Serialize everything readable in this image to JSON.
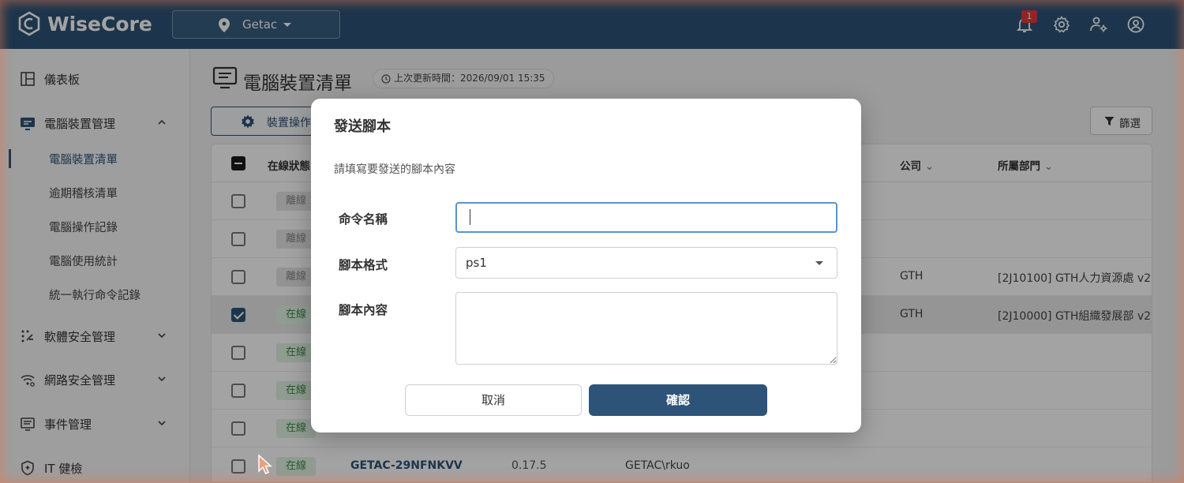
{
  "app": {
    "brand": "WiseCore",
    "site_selector": {
      "value": "Getac"
    },
    "notifications_count": "1"
  },
  "sidebar": {
    "items": [
      {
        "label": "儀表板",
        "icon": "dashboard-icon"
      },
      {
        "label": "電腦裝置管理",
        "icon": "computer-icon",
        "expanded": true,
        "children": [
          "電腦裝置清單",
          "逾期稽核清單",
          "電腦操作記錄",
          "電腦使用統計",
          "統一執行命令記錄"
        ]
      },
      {
        "label": "軟體安全管理",
        "icon": "software-icon"
      },
      {
        "label": "網路安全管理",
        "icon": "wifi-icon"
      },
      {
        "label": "事件管理",
        "icon": "event-icon"
      },
      {
        "label": "IT 健檢",
        "icon": "shield-icon"
      }
    ]
  },
  "page": {
    "title": "電腦裝置清單",
    "last_update": "上次更新時間：2026/09/01 15:35",
    "device_op_label": "裝置操作",
    "filter_label": "篩選"
  },
  "table": {
    "columns": [
      "在線狀態",
      "公司",
      "所屬部門"
    ],
    "rows": [
      {
        "status": "離線",
        "online": false,
        "checked": false,
        "name": "",
        "version": "",
        "user": "",
        "company": "",
        "dept": ""
      },
      {
        "status": "離線",
        "online": false,
        "checked": false,
        "name": "",
        "version": "",
        "user": "",
        "company": "",
        "dept": ""
      },
      {
        "status": "離線",
        "online": false,
        "checked": false,
        "name": "",
        "version": "",
        "user": "",
        "company": "GTH",
        "dept": "[2J10100] GTH人力資源處 v2"
      },
      {
        "status": "在線",
        "online": true,
        "checked": true,
        "name": "",
        "version": "",
        "user": "",
        "company": "GTH",
        "dept": "[2J10000] GTH組織發展部 v2"
      },
      {
        "status": "在線",
        "online": true,
        "checked": false,
        "name": "",
        "version": "",
        "user": "",
        "company": "",
        "dept": ""
      },
      {
        "status": "在線",
        "online": true,
        "checked": false,
        "name": "",
        "version": "",
        "user": "",
        "company": "",
        "dept": ""
      },
      {
        "status": "在線",
        "online": true,
        "checked": false,
        "name": "",
        "version": "",
        "user": "",
        "company": "",
        "dept": ""
      },
      {
        "status": "在線",
        "online": true,
        "checked": false,
        "name": "GETAC-29NFNKVV",
        "version": "0.17.5",
        "user": "GETAC\\rkuo",
        "company": "",
        "dept": ""
      }
    ]
  },
  "modal": {
    "title": "發送腳本",
    "description": "請填寫要發送的腳本內容",
    "fields": {
      "command_name": {
        "label": "命令名稱",
        "value": "",
        "placeholder": ""
      },
      "script_format": {
        "label": "腳本格式",
        "value": "ps1"
      },
      "script_content": {
        "label": "腳本內容",
        "value": ""
      }
    },
    "cancel_label": "取消",
    "confirm_label": "確認"
  },
  "colors": {
    "primary": "#2d5478",
    "online_text": "#3b8c46",
    "offline_text": "#888888",
    "focus_border": "#5a93cf"
  }
}
